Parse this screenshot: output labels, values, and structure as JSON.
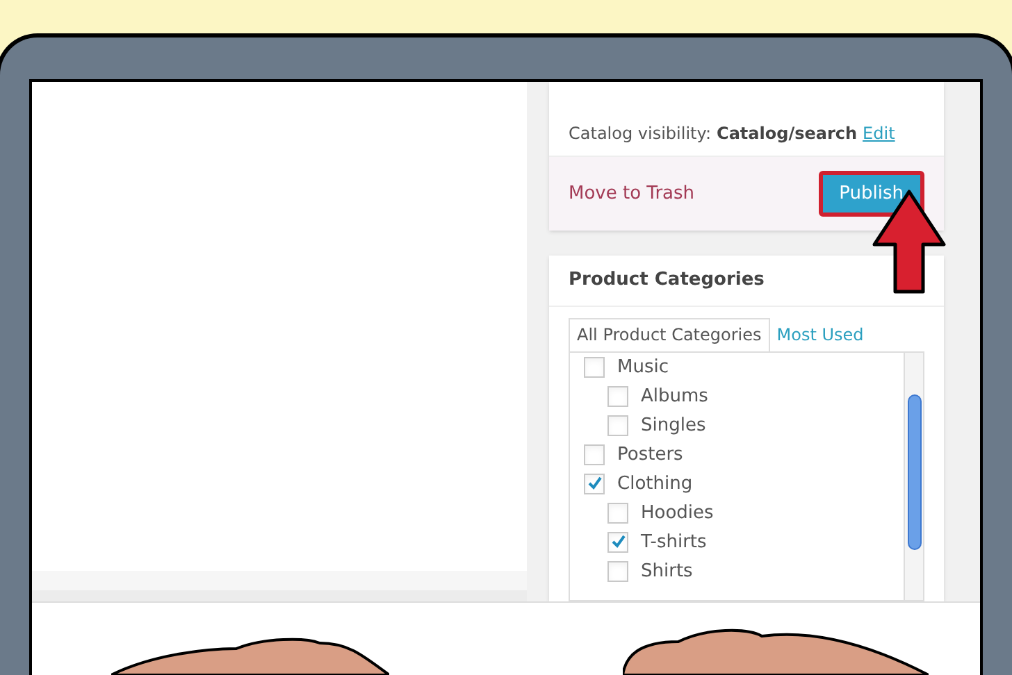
{
  "publish_box": {
    "visibility_label": "Catalog visibility:",
    "visibility_value": "Catalog/search",
    "edit_link": "Edit",
    "trash_link": "Move to Trash",
    "publish_button": "Publish",
    "publish_highlighted": true
  },
  "product_categories": {
    "title": "Product Categories",
    "tabs": [
      {
        "label": "All Product Categories",
        "selected": true
      },
      {
        "label": "Most Used",
        "selected": false
      }
    ],
    "items": [
      {
        "label": "Music",
        "checked": false,
        "children": [
          {
            "label": "Albums",
            "checked": false
          },
          {
            "label": "Singles",
            "checked": false
          }
        ]
      },
      {
        "label": "Posters",
        "checked": false
      },
      {
        "label": "Clothing",
        "checked": true,
        "children": [
          {
            "label": "Hoodies",
            "checked": false
          },
          {
            "label": "T-shirts",
            "checked": true
          },
          {
            "label": "Shirts",
            "checked": false
          }
        ]
      }
    ]
  }
}
